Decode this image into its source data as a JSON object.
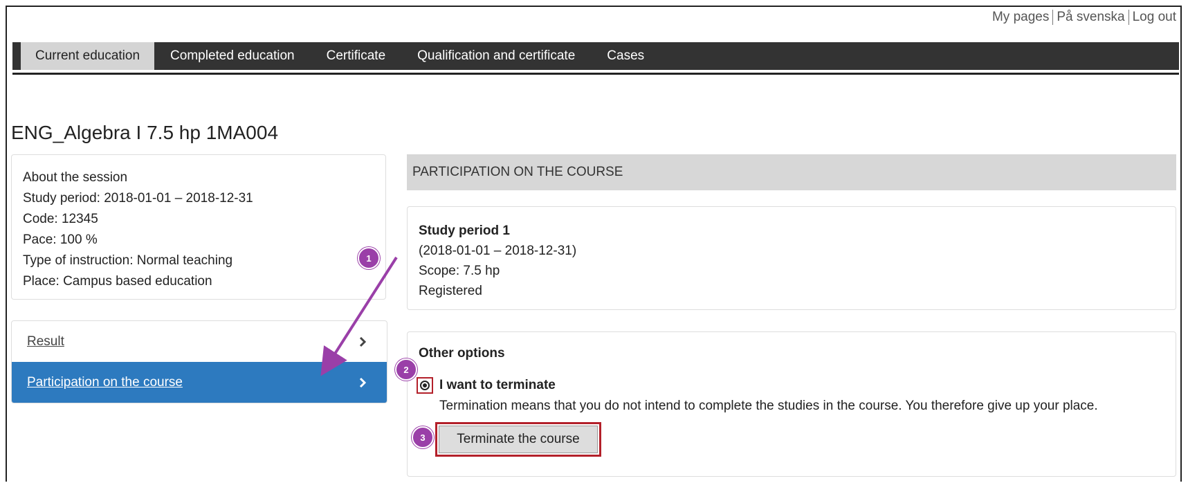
{
  "toplinks": [
    "My pages",
    "På svenska",
    "Log out"
  ],
  "nav": {
    "tabs": [
      "Current education",
      "Completed education",
      "Certificate",
      "Qualification and certificate",
      "Cases"
    ],
    "active_tab": "Current education"
  },
  "page_title": "ENG_Algebra I 7.5 hp 1MA004",
  "session": {
    "heading": "About the session",
    "study_period": "Study period:  2018-01-01 – 2018-12-31",
    "code": "Code:  12345",
    "pace": "Pace:  100 %",
    "type": "Type of instruction:  Normal teaching",
    "place": "Place:  Campus based education"
  },
  "side_nav": {
    "items": [
      "Result",
      "Participation on the course"
    ],
    "active": "Participation on the course"
  },
  "section_head": "PARTICIPATION ON THE COURSE",
  "study_period_panel": {
    "title": "Study period 1",
    "dates": "(2018-01-01 – 2018-12-31)",
    "scope": "Scope:  7.5 hp",
    "status": "Registered"
  },
  "other_options": {
    "heading": "Other options",
    "option_label": "I want to terminate",
    "option_selected": true,
    "option_desc": "Termination means that you do not intend to complete the studies in the course. You therefore give up your place.",
    "button_label": "Terminate the course"
  },
  "annotations": {
    "markers": [
      "1",
      "2",
      "3"
    ],
    "color": "#9a3fa8",
    "highlight_color": "#b3202a"
  },
  "colors": {
    "nav_bg": "#333333",
    "active_item": "#2d7abf"
  }
}
